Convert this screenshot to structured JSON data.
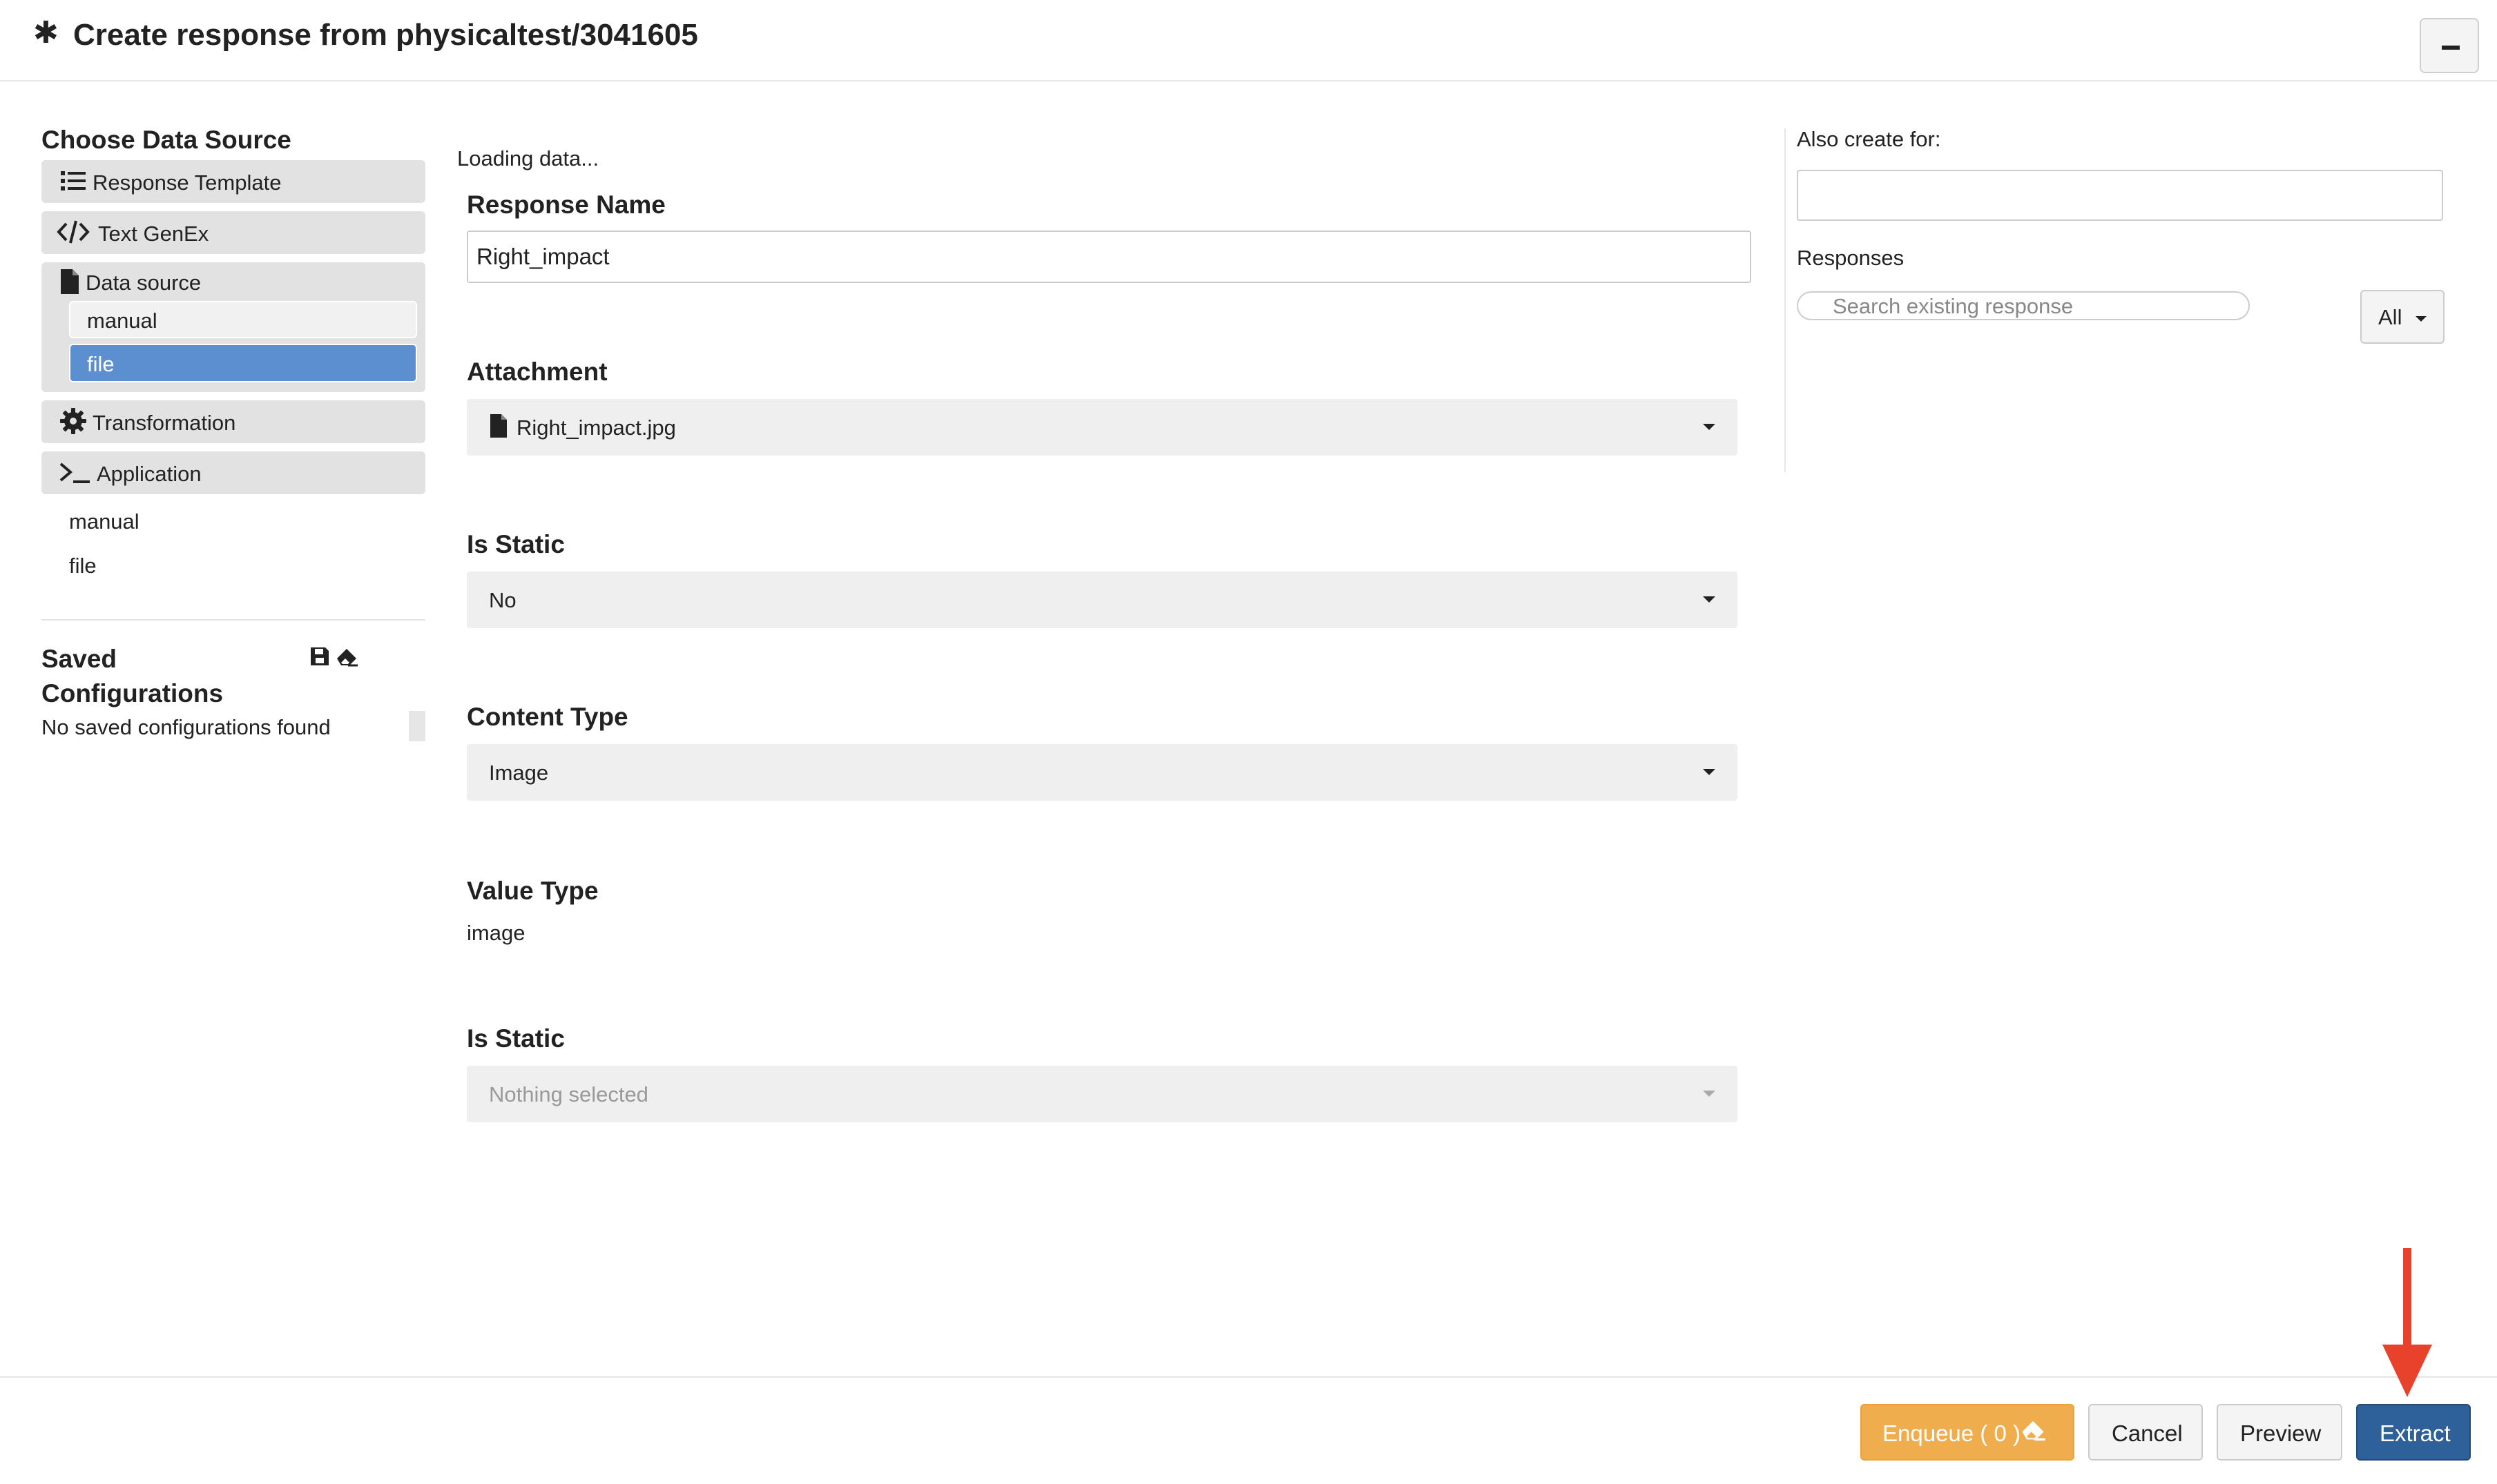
{
  "header": {
    "title": "Create response from physicaltest/3041605",
    "minimize_icon": "minus-icon"
  },
  "sidebar": {
    "choose_title": "Choose Data Source",
    "sources": [
      {
        "label": "Response Template",
        "icon": "list-icon"
      },
      {
        "label": "Text GenEx",
        "icon": "code-icon"
      },
      {
        "label": "Data source",
        "icon": "file-icon",
        "options": [
          "manual",
          "file"
        ],
        "selected": "file"
      },
      {
        "label": "Transformation",
        "icon": "gear-icon"
      },
      {
        "label": "Application",
        "icon": "terminal-icon"
      }
    ],
    "app_links": [
      "manual",
      "file"
    ],
    "saved_title": "Saved Configurations",
    "no_saved": "No saved configurations found"
  },
  "form": {
    "loading": "Loading data...",
    "response_name_label": "Response Name",
    "response_name_value": "Right_impact",
    "attachment_label": "Attachment",
    "attachment_value": "Right_impact.jpg",
    "is_static_label": "Is Static",
    "is_static_value": "No",
    "content_type_label": "Content Type",
    "content_type_value": "Image",
    "value_type_label": "Value Type",
    "value_type_value": "image",
    "is_static2_label": "Is Static",
    "is_static2_placeholder": "Nothing selected"
  },
  "right_panel": {
    "also_create_label": "Also create for:",
    "also_create_value": "",
    "responses_label": "Responses",
    "search_placeholder": "Search existing response",
    "filter_label": "All"
  },
  "footer": {
    "enqueue_label": "Enqueue ( 0 )",
    "cancel_label": "Cancel",
    "preview_label": "Preview",
    "extract_label": "Extract"
  },
  "colors": {
    "primary": "#2e6099",
    "warning": "#f0ad4e",
    "selected": "#5b8fcf",
    "annotation_arrow": "#e8412c"
  }
}
